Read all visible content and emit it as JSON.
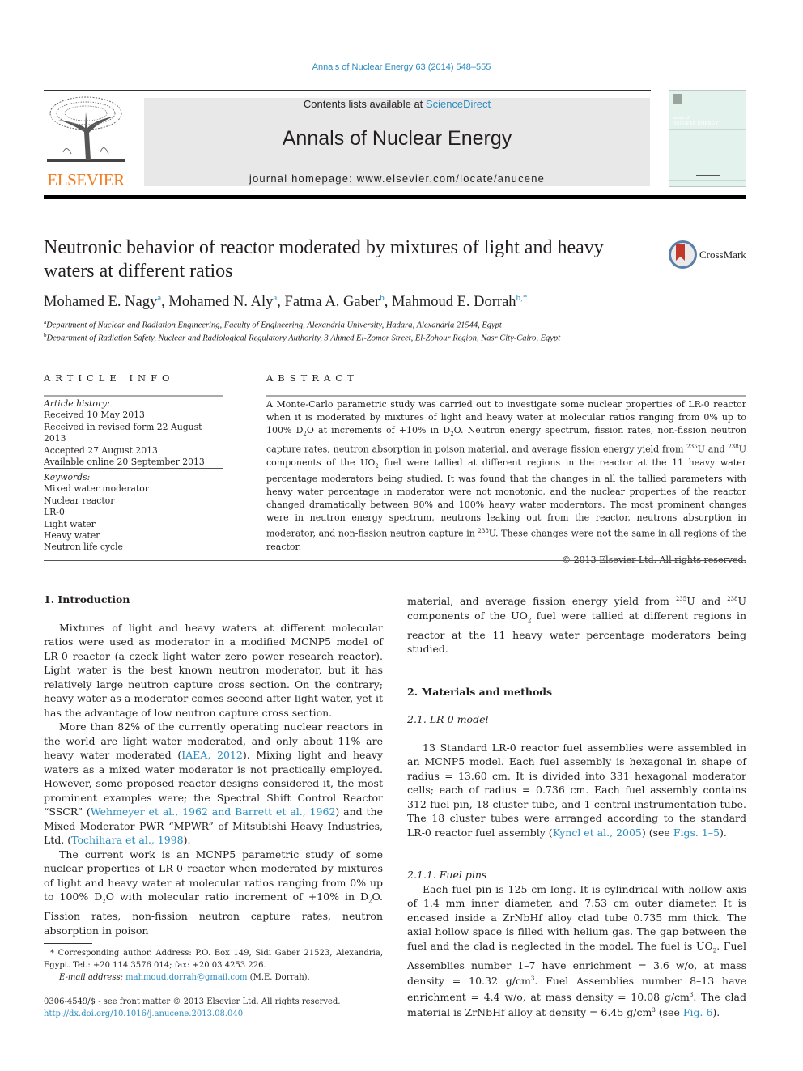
{
  "header": {
    "journal_ref": "Annals of Nuclear Energy 63 (2014) 548–555",
    "contents_prefix": "Contents lists available at ",
    "contents_link": "ScienceDirect",
    "journal_title": "Annals of Nuclear Energy",
    "homepage": "journal homepage: www.elsevier.com/locate/anucene",
    "publisher_logo_text": "ELSEVIER",
    "cover_line1": "annals of",
    "cover_line2": "NUCLEAR ENERGY",
    "crossmark_label": "CrossMark"
  },
  "article": {
    "title": "Neutronic behavior of reactor moderated by mixtures of light and heavy waters at different ratios",
    "authors": [
      {
        "name": "Mohamed E. Nagy",
        "affil": "a"
      },
      {
        "name": "Mohamed N. Aly",
        "affil": "a"
      },
      {
        "name": "Fatma A. Gaber",
        "affil": "b"
      },
      {
        "name": "Mahmoud E. Dorrah",
        "affil": "b,*"
      }
    ],
    "affiliations": [
      {
        "mark": "a",
        "text": "Department of Nuclear and Radiation Engineering, Faculty of Engineering, Alexandria University, Hadara, Alexandria 21544, Egypt"
      },
      {
        "mark": "b",
        "text": "Department of Radiation Safety, Nuclear and Radiological Regulatory Authority, 3 Ahmed El-Zomor Street, El-Zohour Region, Nasr City-Cairo, Egypt"
      }
    ]
  },
  "article_info": {
    "heading": "ARTICLE INFO",
    "history_label": "Article history:",
    "history": [
      "Received 10 May 2013",
      "Received in revised form 22 August 2013",
      "Accepted 27 August 2013",
      "Available online 20 September 2013"
    ],
    "keywords_label": "Keywords:",
    "keywords": [
      "Mixed water moderator",
      "Nuclear reactor",
      "LR-0",
      "Light water",
      "Heavy water",
      "Neutron life cycle"
    ]
  },
  "abstract": {
    "heading": "ABSTRACT",
    "t1": "A Monte-Carlo parametric study was carried out to investigate some nuclear properties of LR-0 reactor when it is moderated by mixtures of light and heavy water at molecular ratios ranging from 0% up to 100% D",
    "t2": "O at increments of +10% in D",
    "t3": "O. Neutron energy spectrum, fission rates, non-fission neutron capture rates, neutron absorption in poison material, and average fission energy yield from ",
    "t4": "U and ",
    "t5": "U components of the UO",
    "t6": " fuel were tallied at different regions in the reactor at the 11 heavy water percentage moderators being studied. It was found that the changes in all the tallied parameters with heavy water percentage in moderator were not monotonic, and the nuclear properties of the reactor changed dramatically between 90% and 100% heavy water moderators. The most prominent changes were in neutron energy spectrum, neutrons leaking out from the reactor, neutrons absorption in moderator, and non-fission neutron capture in ",
    "t7": "U. These changes were not the same in all regions of the reactor.",
    "copyright": "© 2013 Elsevier Ltd. All rights reserved.",
    "sup235": "235",
    "sup238": "238",
    "sub2": "2"
  },
  "body": {
    "intro_heading": "1. Introduction",
    "p1": "Mixtures of light and heavy waters at different molecular ratios were used as moderator in a modified MCNP5 model of LR-0 reactor (a czeck light water zero power research reactor). Light water is the best known neutron moderator, but it has relatively large neutron capture cross section. On the contrary; heavy water as a moderator comes second after light water, yet it has the advantage of low neutron capture cross section.",
    "p2a": "More than 82% of the currently operating nuclear reactors in the world are light water moderated, and only about 11% are heavy water moderated (",
    "p2_ref1": "IAEA, 2012",
    "p2b": "). Mixing light and heavy waters as a mixed water moderator is not practically employed. However, some proposed reactor designs considered it, the most prominent examples were; the Spectral Shift Control Reactor “SSCR” (",
    "p2_ref2": "Wehmeyer et al., 1962 and Barrett et al., 1962",
    "p2c": ") and the Mixed Moderator PWR “MPWR” of Mitsubishi Heavy Industries, Ltd. (",
    "p2_ref3": "Tochihara et al., 1998",
    "p2d": ").",
    "p3a": "The current work is an MCNP5 parametric study of some nuclear properties of LR-0 reactor when moderated by mixtures of light and heavy water at molecular ratios ranging from 0% up to 100% D",
    "p3b": "O with molecular ratio increment of +10% in D",
    "p3c": "O. Fission rates, non-fission neutron capture rates, neutron absorption in poison",
    "p3d": "material, and average fission energy yield from ",
    "p3e": "U and ",
    "p3f": "U components of the UO",
    "p3g": " fuel were tallied at different regions in reactor at the 11 heavy water percentage moderators being studied.",
    "methods_heading": "2. Materials and methods",
    "sub21": "2.1. LR-0 model",
    "p4a": "13 Standard LR-0 reactor fuel assemblies were assembled in an MCNP5 model. Each fuel assembly is hexagonal in shape of radius = 13.60 cm. It is divided into 331 hexagonal moderator cells; each of radius = 0.736 cm. Each fuel assembly contains 312 fuel pin, 18 cluster tube, and 1 central instrumentation tube. The 18 cluster tubes were arranged according to the standard LR-0 reactor fuel assembly (",
    "p4_ref1": "Kyncl et al., 2005",
    "p4b": ") (see ",
    "p4_ref2": "Figs. 1–5",
    "p4c": ").",
    "sub211": "2.1.1. Fuel pins",
    "p5a": "Each fuel pin is 125 cm long. It is cylindrical with hollow axis of 1.4 mm inner diameter, and 7.53 cm outer diameter. It is encased inside a ZrNbHf alloy clad tube 0.735 mm thick. The axial hollow space is filled with helium gas. The gap between the fuel and the clad is neglected in the model. The fuel is UO",
    "p5b": ". Fuel Assemblies number 1–7 have enrichment = 3.6 w/o, at mass density = 10.32 g/cm",
    "p5c": ". Fuel Assemblies number 8–13 have enrichment = 4.4 w/o, at mass density = 10.08 g/cm",
    "p5d": ". The clad material is ZrNbHf alloy at density = 6.45 g/cm",
    "p5e": " (see ",
    "p5_ref": "Fig. 6",
    "p5f": ").",
    "sup3": "3"
  },
  "footnote": {
    "corresponding": "* Corresponding author. Address: P.O. Box 149, Sidi Gaber 21523, Alexandria, Egypt. Tel.: +20 114 3576 014; fax: +20 03 4253 226.",
    "email_label": "E-mail address: ",
    "email": "mahmoud.dorrah@gmail.com",
    "email_suffix": " (M.E. Dorrah).",
    "front_matter": "0306-4549/$ - see front matter © 2013 Elsevier Ltd. All rights reserved.",
    "doi": "http://dx.doi.org/10.1016/j.anucene.2013.08.040"
  },
  "colors": {
    "link": "#2b8bbf",
    "elsevier_orange": "#f07f22",
    "banner_bg": "#e8e8e8"
  }
}
